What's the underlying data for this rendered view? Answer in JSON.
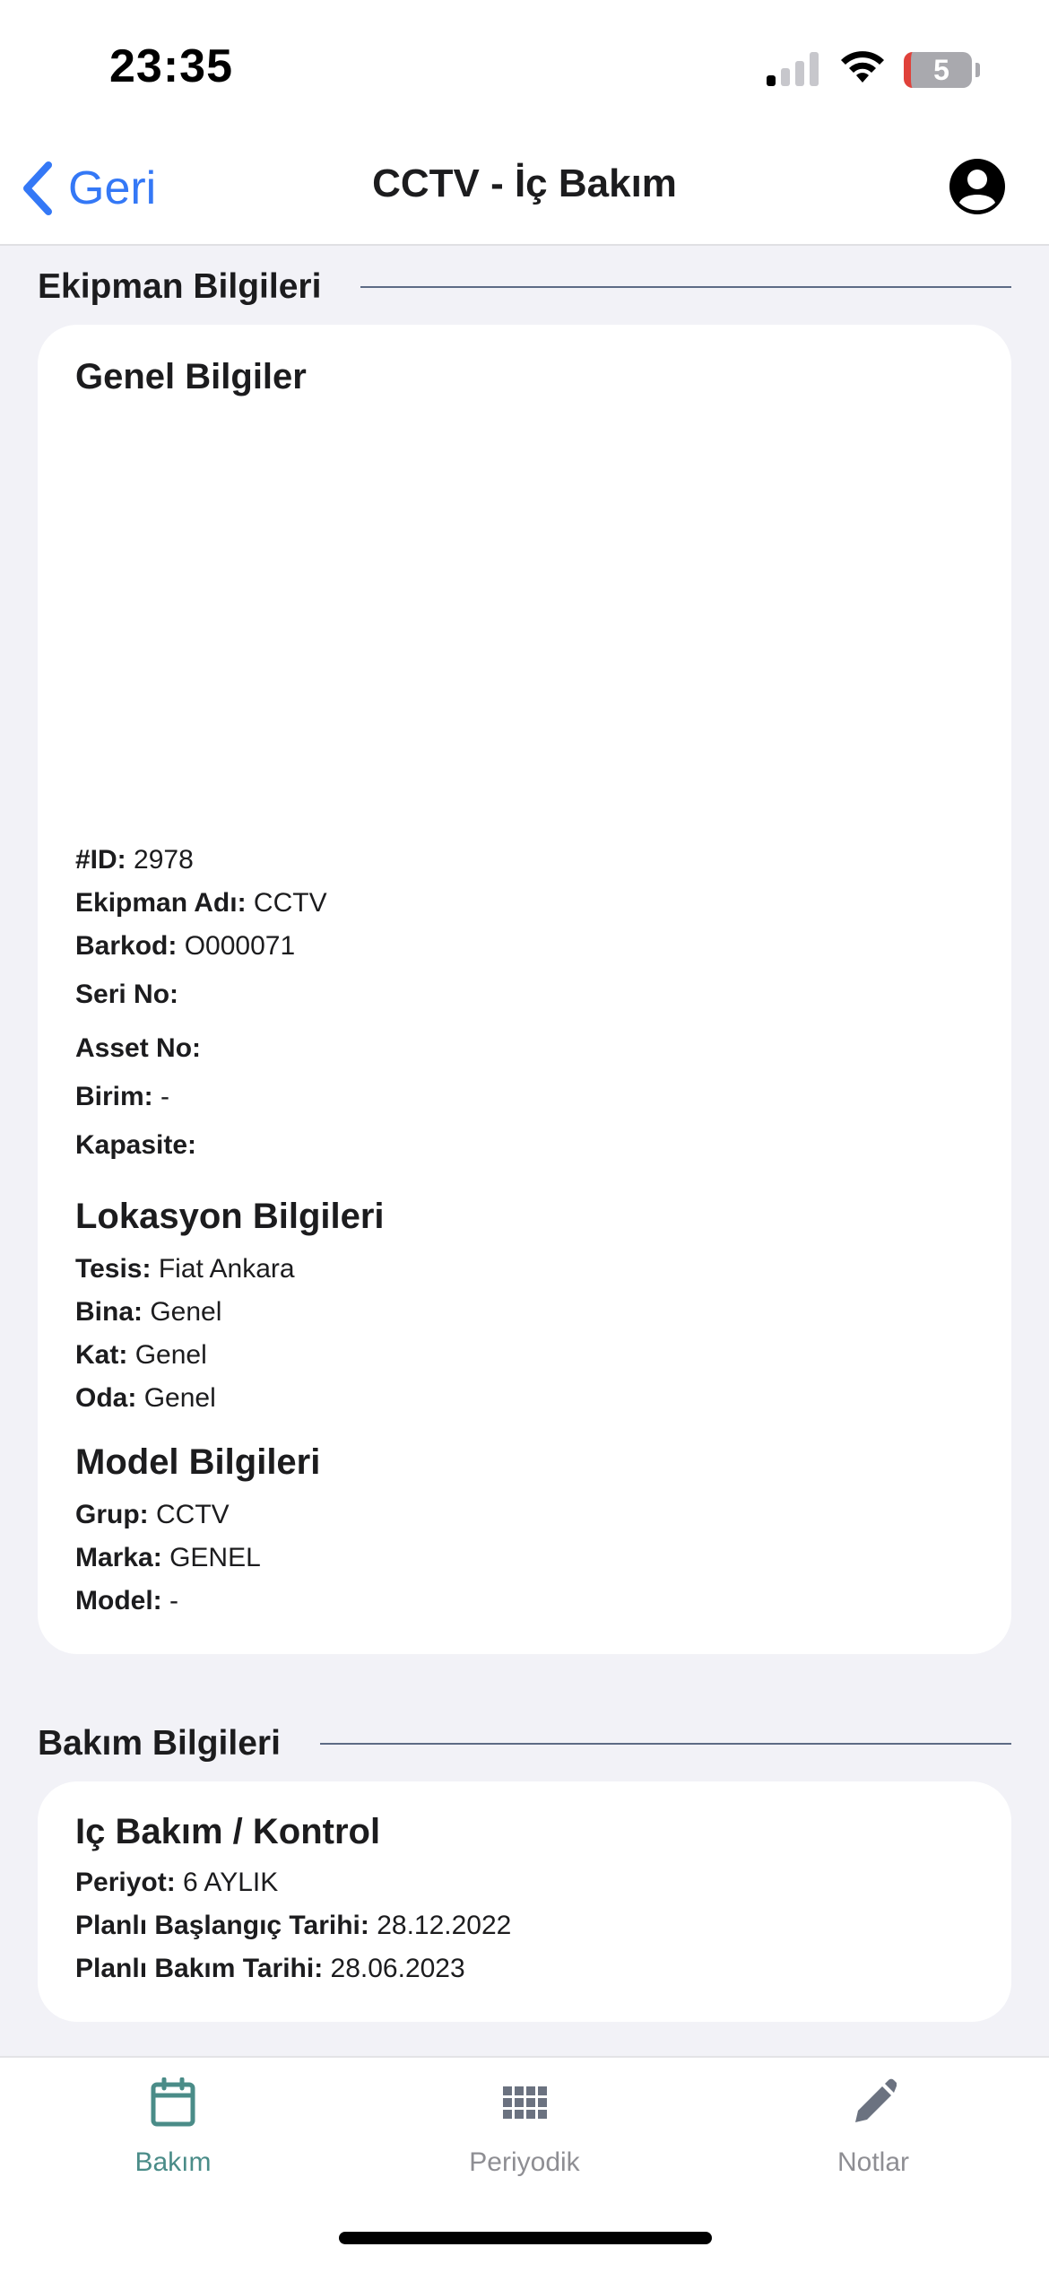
{
  "status_bar": {
    "time": "23:35",
    "battery": "5"
  },
  "nav": {
    "back_label": "Geri",
    "title": "CCTV - İç Bakım"
  },
  "equipment_section": {
    "title": "Ekipman Bilgileri",
    "general": {
      "heading": "Genel Bilgiler",
      "rows": [
        {
          "label": "#ID:",
          "value": "2978"
        },
        {
          "label": "Ekipman Adı:",
          "value": "CCTV"
        },
        {
          "label": "Barkod:",
          "value": "O000071"
        },
        {
          "label": "Seri No:",
          "value": ""
        },
        {
          "label": "Asset No:",
          "value": ""
        },
        {
          "label": "Birim:",
          "value": "-"
        },
        {
          "label": "Kapasite:",
          "value": ""
        }
      ]
    },
    "location": {
      "heading": "Lokasyon Bilgileri",
      "rows": [
        {
          "label": "Tesis:",
          "value": "Fiat Ankara"
        },
        {
          "label": "Bina:",
          "value": "Genel"
        },
        {
          "label": "Kat:",
          "value": "Genel"
        },
        {
          "label": "Oda:",
          "value": "Genel"
        }
      ]
    },
    "model": {
      "heading": "Model Bilgileri",
      "rows": [
        {
          "label": "Grup:",
          "value": "CCTV"
        },
        {
          "label": "Marka:",
          "value": "GENEL"
        },
        {
          "label": "Model:",
          "value": "-"
        }
      ]
    }
  },
  "maintenance_section": {
    "title": "Bakım Bilgileri",
    "heading": "Iç Bakım / Kontrol",
    "rows": [
      {
        "label": "Periyot:",
        "value": "6 AYLIK"
      },
      {
        "label": "Planlı Başlangıç Tarihi:",
        "value": "28.12.2022"
      },
      {
        "label": "Planlı Bakım Tarihi:",
        "value": "28.06.2023"
      }
    ]
  },
  "tabs": [
    {
      "label": "Bakım",
      "icon": "calendar-icon",
      "active": true
    },
    {
      "label": "Periyodik",
      "icon": "grid-icon",
      "active": false
    },
    {
      "label": "Notlar",
      "icon": "pencil-icon",
      "active": false
    }
  ],
  "colors": {
    "accent": "#3478f6",
    "active_tab": "#4a8c88",
    "inactive_tab": "#8e8e93",
    "rule": "#5d6b85"
  }
}
